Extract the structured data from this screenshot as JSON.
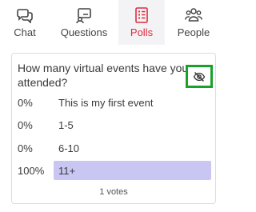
{
  "tabs": [
    {
      "label": "Chat",
      "icon": "chat-icon",
      "active": false
    },
    {
      "label": "Questions",
      "icon": "questions-icon",
      "active": false
    },
    {
      "label": "Polls",
      "icon": "polls-icon",
      "active": true
    },
    {
      "label": "People",
      "icon": "people-icon",
      "active": false
    }
  ],
  "colors": {
    "accent": "#e02a3e",
    "highlight_border": "#1aa12a",
    "bar_fill": "#c9c6f3"
  },
  "poll": {
    "question": "How many virtual events have you attended?",
    "hide_icon": "eye-slash-icon",
    "options": [
      {
        "percent_label": "0%",
        "text": "This is my first event",
        "share": 0
      },
      {
        "percent_label": "0%",
        "text": "1-5",
        "share": 0
      },
      {
        "percent_label": "0%",
        "text": "6-10",
        "share": 0
      },
      {
        "percent_label": "100%",
        "text": "11+",
        "share": 1
      }
    ],
    "votes_label": "1 votes"
  }
}
